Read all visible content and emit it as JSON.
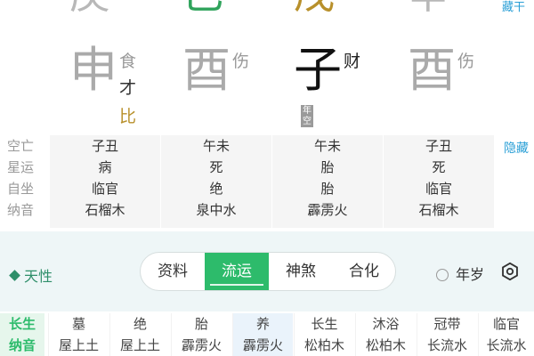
{
  "pillars": [
    {
      "stem": "庚",
      "stem_color": "#b8b8b8",
      "branch": "申",
      "branch_color": "#aaaaaa",
      "gods": [
        {
          "text": "食",
          "color": "#999999"
        },
        {
          "text": "才",
          "color": "#333333"
        },
        {
          "text": "比",
          "color": "#b8902b"
        }
      ],
      "note": ""
    },
    {
      "stem": "己",
      "stem_color": "#2fa35b",
      "branch": "酉",
      "branch_color": "#aaaaaa",
      "gods": [
        {
          "text": "伤",
          "color": "#999999"
        }
      ],
      "note": ""
    },
    {
      "stem": "戊",
      "stem_color": "#b8902b",
      "branch": "子",
      "branch_color": "#111111",
      "gods": [
        {
          "text": "财",
          "color": "#222222"
        }
      ],
      "note": "年空"
    },
    {
      "stem": "辛",
      "stem_color": "#b8b8b8",
      "branch": "酉",
      "branch_color": "#aaaaaa",
      "gods": [
        {
          "text": "伤",
          "color": "#999999"
        }
      ],
      "note": ""
    }
  ],
  "top_hide": "藏干",
  "info": {
    "labels": [
      "空亡",
      "星运",
      "自坐",
      "纳音"
    ],
    "columns": [
      [
        "子丑",
        "病",
        "临官",
        "石榴木"
      ],
      [
        "午未",
        "死",
        "绝",
        "泉中水"
      ],
      [
        "午未",
        "胎",
        "胎",
        "霹雳火"
      ],
      [
        "子丑",
        "死",
        "临官",
        "石榴木"
      ]
    ],
    "hide": "隐藏"
  },
  "toolbar": {
    "tianxing": "天性",
    "tabs": [
      "资料",
      "流运",
      "神煞",
      "合化"
    ],
    "active_tab": 1,
    "year_label": "年岁"
  },
  "bottom": {
    "headers": [
      "长生",
      "纳音"
    ],
    "columns": [
      [
        "墓",
        "屋上土"
      ],
      [
        "绝",
        "屋上土"
      ],
      [
        "胎",
        "霹雳火"
      ],
      [
        "养",
        "霹雳火"
      ],
      [
        "长生",
        "松柏木"
      ],
      [
        "沐浴",
        "松柏木"
      ],
      [
        "冠带",
        "长流水"
      ],
      [
        "临官",
        "长流水"
      ]
    ],
    "highlight": 3
  }
}
